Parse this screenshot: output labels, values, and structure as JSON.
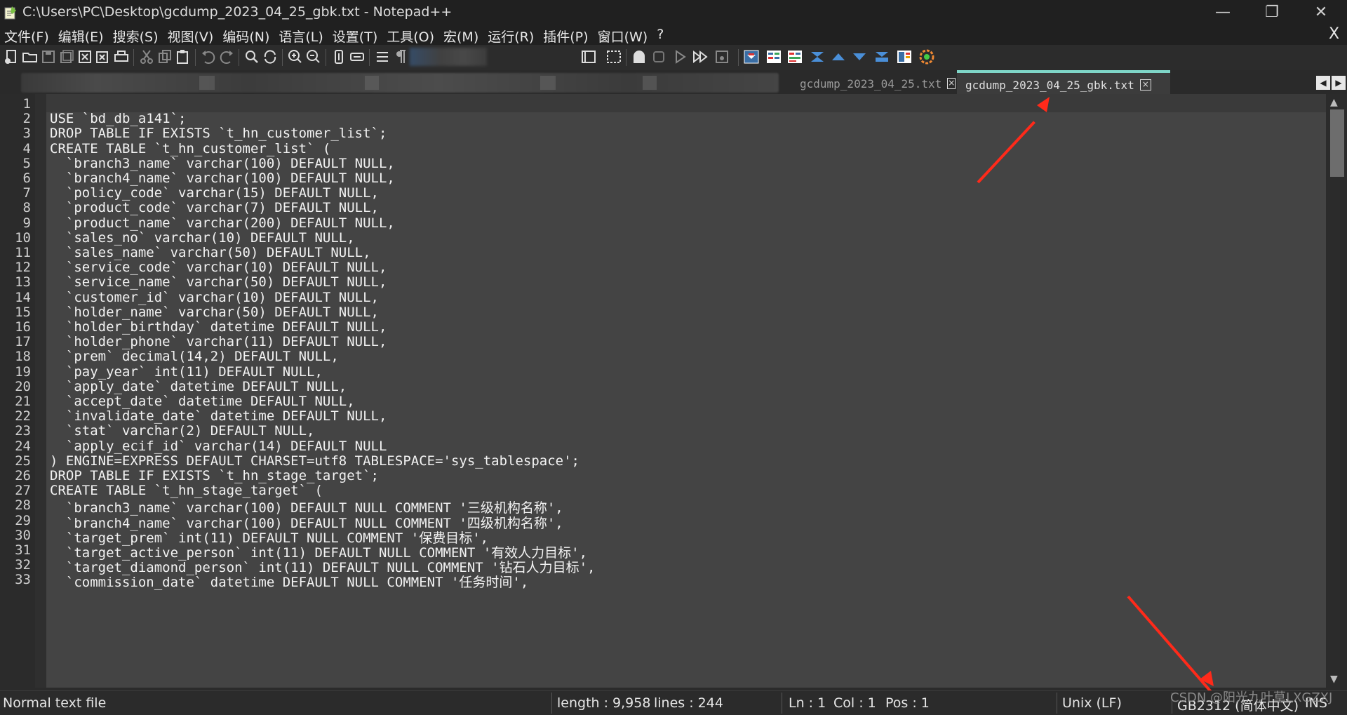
{
  "window": {
    "title": "C:\\Users\\PC\\Desktop\\gcdump_2023_04_25_gbk.txt - Notepad++",
    "minimize_glyph": "—",
    "restore_glyph": "❐",
    "close_glyph": "✕"
  },
  "menu": {
    "items": [
      "文件(F)",
      "编辑(E)",
      "搜索(S)",
      "视图(V)",
      "编码(N)",
      "语言(L)",
      "设置(T)",
      "工具(O)",
      "宏(M)",
      "运行(R)",
      "插件(P)",
      "窗口(W)",
      "?"
    ],
    "close_glyph": "X"
  },
  "tabs": [
    {
      "label": "gcdump_2023_04_25.txt",
      "active": false,
      "close_glyph": "×"
    },
    {
      "label": "gcdump_2023_04_25_gbk.txt",
      "active": true,
      "close_glyph": "×"
    }
  ],
  "tab_scroll": {
    "left": "◀",
    "right": "▶"
  },
  "editor": {
    "lines": [
      "",
      "USE `bd_db_a141`;",
      "DROP TABLE IF EXISTS `t_hn_customer_list`;",
      "CREATE TABLE `t_hn_customer_list` (",
      "  `branch3_name` varchar(100) DEFAULT NULL,",
      "  `branch4_name` varchar(100) DEFAULT NULL,",
      "  `policy_code` varchar(15) DEFAULT NULL,",
      "  `product_code` varchar(7) DEFAULT NULL,",
      "  `product_name` varchar(200) DEFAULT NULL,",
      "  `sales_no` varchar(10) DEFAULT NULL,",
      "  `sales_name` varchar(50) DEFAULT NULL,",
      "  `service_code` varchar(10) DEFAULT NULL,",
      "  `service_name` varchar(50) DEFAULT NULL,",
      "  `customer_id` varchar(10) DEFAULT NULL,",
      "  `holder_name` varchar(50) DEFAULT NULL,",
      "  `holder_birthday` datetime DEFAULT NULL,",
      "  `holder_phone` varchar(11) DEFAULT NULL,",
      "  `prem` decimal(14,2) DEFAULT NULL,",
      "  `pay_year` int(11) DEFAULT NULL,",
      "  `apply_date` datetime DEFAULT NULL,",
      "  `accept_date` datetime DEFAULT NULL,",
      "  `invalidate_date` datetime DEFAULT NULL,",
      "  `stat` varchar(2) DEFAULT NULL,",
      "  `apply_ecif_id` varchar(14) DEFAULT NULL",
      ") ENGINE=EXPRESS DEFAULT CHARSET=utf8 TABLESPACE='sys_tablespace';",
      "DROP TABLE IF EXISTS `t_hn_stage_target`;",
      "CREATE TABLE `t_hn_stage_target` (",
      "  `branch3_name` varchar(100) DEFAULT NULL COMMENT '三级机构名称',",
      "  `branch4_name` varchar(100) DEFAULT NULL COMMENT '四级机构名称',",
      "  `target_prem` int(11) DEFAULT NULL COMMENT '保费目标',",
      "  `target_active_person` int(11) DEFAULT NULL COMMENT '有效人力目标',",
      "  `target_diamond_person` int(11) DEFAULT NULL COMMENT '钻石人力目标',",
      "  `commission_date` datetime DEFAULT NULL COMMENT '任务时间',"
    ]
  },
  "status": {
    "file_type": "Normal text file",
    "length": "length : 9,958",
    "lines": "lines : 244",
    "ln": "Ln : 1",
    "col": "Col : 1",
    "pos": "Pos : 1",
    "eol": "Unix (LF)",
    "encoding": "GB2312 (简体中文)",
    "mode": "INS"
  },
  "watermark": "CSDN @阳光九叶草LXGZXJ",
  "colors": {
    "editor_bg": "#444444",
    "active_tab_accent": "#7fd6c8",
    "arrow": "#ff2a1a"
  }
}
